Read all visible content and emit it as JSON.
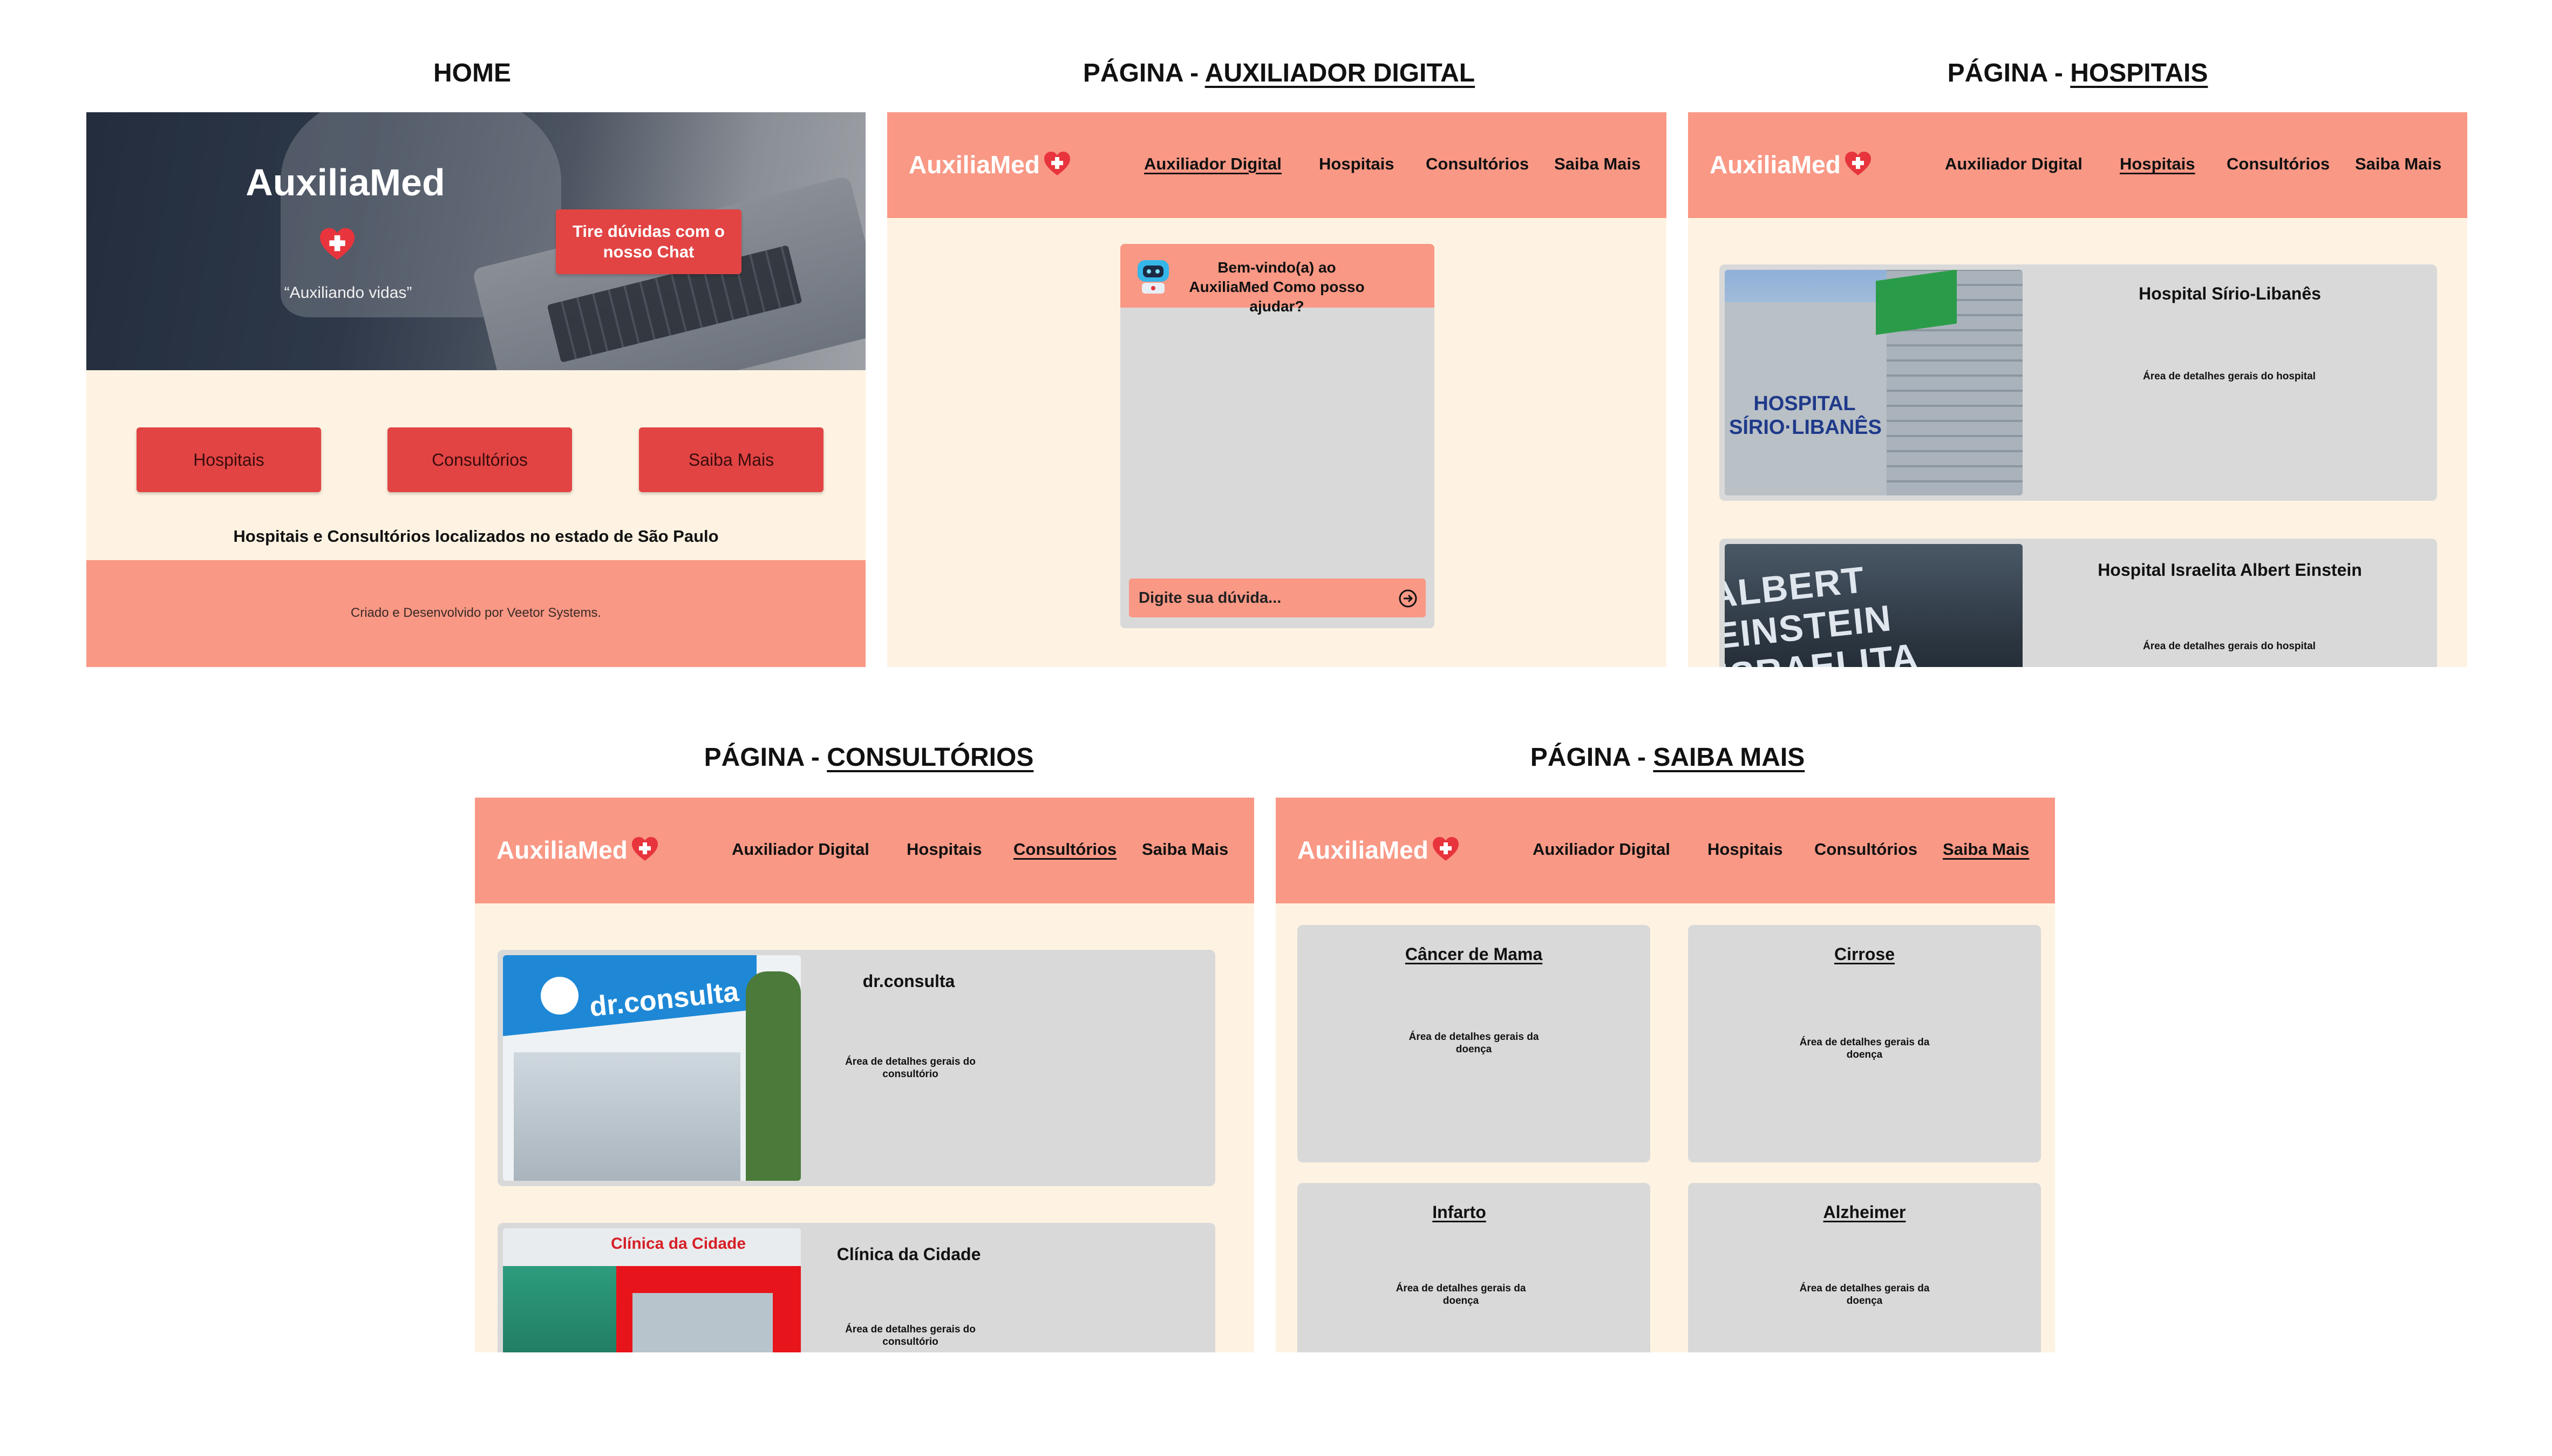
{
  "titles": {
    "home": "HOME",
    "auxiliador": {
      "prefix": "PÁGINA - ",
      "name": "AUXILIADOR DIGITAL"
    },
    "hospitais": {
      "prefix": "PÁGINA - ",
      "name": "HOSPITAIS"
    },
    "consultorios": {
      "prefix": "PÁGINA - ",
      "name": "CONSULTÓRIOS"
    },
    "saiba_mais": {
      "prefix": "PÁGINA - ",
      "name": "SAIBA MAIS"
    }
  },
  "brand": {
    "name": "AuxiliaMed",
    "icon": "heart-cross-icon",
    "color": "#f99885",
    "accent": "#e24444",
    "cream": "#fef3e2"
  },
  "nav": [
    "Auxiliador Digital",
    "Hospitais",
    "Consultórios",
    "Saiba Mais"
  ],
  "home": {
    "app_title": "AuxiliaMed",
    "tagline": "“Auxiliando vidas”",
    "chat_button": "Tire dúvidas com o nosso Chat",
    "buttons": [
      "Hospitais",
      "Consultórios",
      "Saiba Mais"
    ],
    "subtitle": "Hospitais e Consultórios localizados no estado de São Paulo",
    "footer": "Criado e Desenvolvido por Veetor Systems."
  },
  "chat": {
    "greeting": "Bem-vindo(a) ao AuxiliaMed Como posso ajudar?",
    "bot_icon": "robot-icon",
    "placeholder": "Digite sua dúvida...",
    "send_icon": "arrow-right-circle-icon"
  },
  "hospitais": [
    {
      "name": "Hospital Sírio-Libanês",
      "details": "Área de detalhes gerais do hospital",
      "photo_text": "HOSPITAL SÍRIO·LIBANÊS"
    },
    {
      "name": "Hospital Israelita Albert Einstein",
      "details": "Área de detalhes gerais do hospital",
      "photo_text": "ALBERT EINSTEIN ISRAELITA"
    }
  ],
  "consultorios": [
    {
      "name": "dr.consulta",
      "details": "Área de detalhes gerais do consultório",
      "photo_text": "dr.consulta"
    },
    {
      "name": "Clínica da Cidade",
      "details": "Área de detalhes gerais do consultório",
      "photo_text": "Clínica da Cidade"
    }
  ],
  "doencas": [
    {
      "name": "Câncer de Mama",
      "details": "Área de detalhes gerais da doença"
    },
    {
      "name": "Cirrose",
      "details": "Área de detalhes gerais da doença"
    },
    {
      "name": "Infarto",
      "details": "Área de detalhes gerais da doença"
    },
    {
      "name": "Alzheimer",
      "details": "Área de detalhes gerais da doença"
    }
  ]
}
